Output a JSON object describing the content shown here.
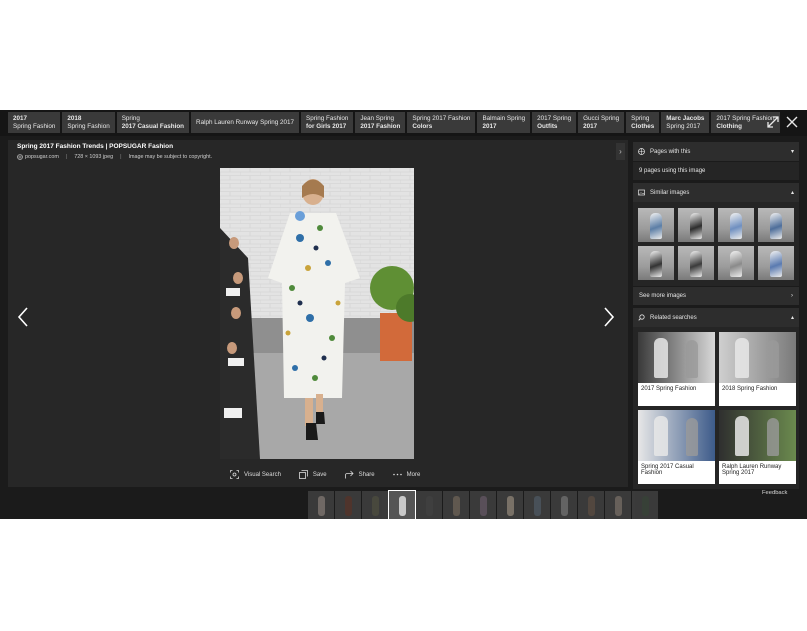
{
  "chips": [
    {
      "line1": "2017",
      "line2": "Spring Fashion",
      "bold1": true,
      "bold2": false
    },
    {
      "line1": "2018",
      "line2": "Spring Fashion",
      "bold1": true,
      "bold2": false
    },
    {
      "line1": "Spring",
      "line2": "2017 Casual Fashion",
      "bold1": false,
      "bold2": true
    },
    {
      "line1": "Ralph Lauren Runway Spring 2017",
      "line2": "",
      "bold1": false,
      "bold2": false
    },
    {
      "line1": "Spring Fashion",
      "line2": "for Girls 2017",
      "bold1": false,
      "bold2": true
    },
    {
      "line1": "Jean Spring",
      "line2": "2017 Fashion",
      "bold1": false,
      "bold2": true
    },
    {
      "line1": "Spring 2017 Fashion",
      "line2": "Colors",
      "bold1": false,
      "bold2": true
    },
    {
      "line1": "Balmain Spring",
      "line2": "2017",
      "bold1": false,
      "bold2": true
    },
    {
      "line1": "2017 Spring",
      "line2": "Outfits",
      "bold1": false,
      "bold2": true
    },
    {
      "line1": "Gucci Spring",
      "line2": "2017",
      "bold1": false,
      "bold2": true
    },
    {
      "line1": "Spring",
      "line2": "Clothes",
      "bold1": false,
      "bold2": true
    },
    {
      "line1": "Marc Jacobs",
      "line2": "Spring 2017",
      "bold1": true,
      "bold2": false
    },
    {
      "line1": "2017 Spring Fashion",
      "line2": "Clothing",
      "bold1": false,
      "bold2": true
    }
  ],
  "image": {
    "title": "Spring 2017 Fashion Trends | POPSUGAR Fashion",
    "source": "popsugar.com",
    "size": "728 × 1093 jpeg",
    "copyright": "Image may be subject to copyright."
  },
  "actions": {
    "visual_search": "Visual Search",
    "save": "Save",
    "share": "Share",
    "more": "More"
  },
  "panel": {
    "pages_header": "Pages with this",
    "pages_count": "9 pages using this image",
    "similar_header": "Similar images",
    "see_more": "See more images",
    "related_header": "Related searches",
    "related": [
      {
        "label": "2017 Spring Fashion"
      },
      {
        "label": "2018 Spring Fashion"
      },
      {
        "label": "Spring 2017 Casual Fashion"
      },
      {
        "label": "Ralph Lauren Runway Spring 2017"
      }
    ]
  },
  "feedback": "Feedback",
  "colors": {
    "background": "#1b1b1b",
    "chip": "#3a3a3a",
    "panel_header": "#2d2d2d"
  }
}
